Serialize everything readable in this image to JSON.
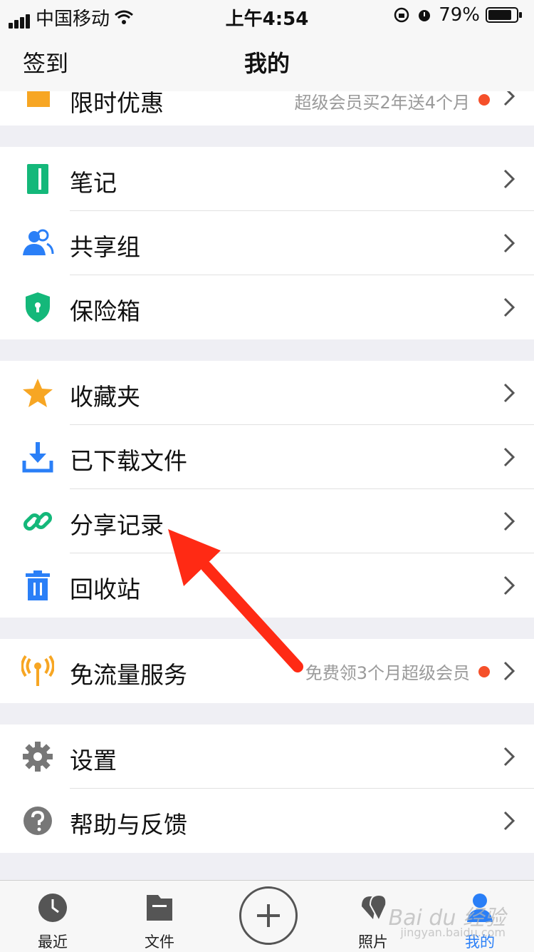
{
  "status_bar": {
    "carrier": "中国移动",
    "time": "上午4:54",
    "battery": "79%"
  },
  "nav": {
    "left": "签到",
    "title": "我的"
  },
  "sections": {
    "promo": {
      "label": "限时优惠",
      "sub": "超级会员买2年送4个月"
    },
    "notes": {
      "label": "笔记"
    },
    "share_group": {
      "label": "共享组"
    },
    "safe": {
      "label": "保险箱"
    },
    "favorites": {
      "label": "收藏夹"
    },
    "downloaded": {
      "label": "已下载文件"
    },
    "share_record": {
      "label": "分享记录"
    },
    "recycle": {
      "label": "回收站"
    },
    "free_data": {
      "label": "免流量服务",
      "sub": "免费领3个月超级会员"
    },
    "settings": {
      "label": "设置"
    },
    "help": {
      "label": "帮助与反馈"
    }
  },
  "tabs": {
    "recent": "最近",
    "files": "文件",
    "photos": "照片",
    "mine": "我的"
  },
  "watermark": {
    "main": "Bai du 经验",
    "sub": "jingyan.baidu.com"
  },
  "colors": {
    "accent": "#2a7ff7",
    "arrow": "#ff2a14",
    "notes_green": "#14b87a",
    "star": "#f7a623"
  }
}
